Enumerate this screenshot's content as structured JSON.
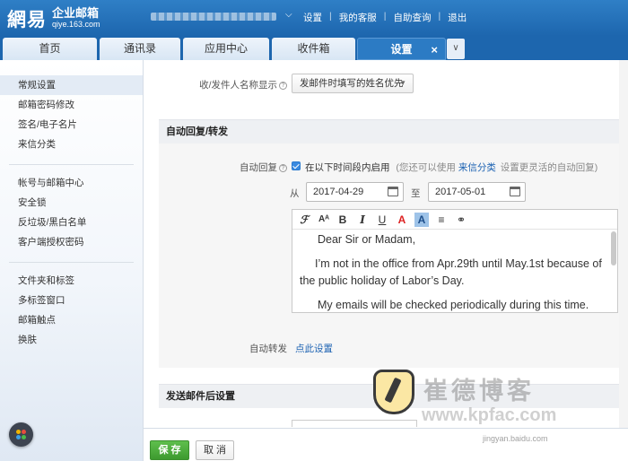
{
  "header": {
    "logo_cn": "網易",
    "logo_title": "企业邮箱",
    "logo_domain": "qiye.163.com",
    "links": [
      "设置",
      "我的客服",
      "自助查询",
      "退出"
    ]
  },
  "tabs": [
    {
      "label": "首页"
    },
    {
      "label": "通讯录"
    },
    {
      "label": "应用中心"
    },
    {
      "label": "收件箱"
    },
    {
      "label": "设置",
      "active": true,
      "close": "×"
    }
  ],
  "tab_more_icon": "chevron-down-icon",
  "sidebar": {
    "groups": [
      [
        "常规设置",
        "邮箱密码修改",
        "签名/电子名片",
        "来信分类"
      ],
      [
        "帐号与邮箱中心",
        "安全锁",
        "反垃圾/黑白名单",
        "客户端授权密码"
      ],
      [
        "文件夹和标签",
        "多标签窗口",
        "邮箱触点",
        "换肤"
      ]
    ]
  },
  "main": {
    "sender_name_label": "收/发件人名称显示",
    "sender_name_value": "发邮件时填写的姓名优先",
    "auto_section_title": "自动回复/转发",
    "auto_reply_label": "自动回复",
    "auto_reply_enable": "在以下时间段内启用",
    "auto_reply_hint_pre": "(您还可以使用",
    "auto_reply_hint_link": "来信分类",
    "auto_reply_hint_post": "设置更灵活的自动回复)",
    "from_label": "从",
    "to_label": "至",
    "date_from": "2017-04-29",
    "date_to": "2017-05-01",
    "editor_paragraphs": [
      "Dear Sir or Madam,",
      "I’m not in the office from Apr.29th until May.1st because of the public holiday of Labor’s Day.",
      "My emails will be checked periodically during this time."
    ],
    "auto_forward_label": "自动转发",
    "auto_forward_link": "点此设置",
    "after_send_title": "发送邮件后设置"
  },
  "footer": {
    "save": "保 存",
    "cancel": "取 消"
  },
  "watermark": {
    "title": "崔德博客",
    "site": "www.kpfac.com",
    "foot": "jingyan.baidu.com"
  },
  "colors": {
    "brand": "#1d66ae",
    "save": "#3d9a2f",
    "link": "#1c62b2"
  }
}
